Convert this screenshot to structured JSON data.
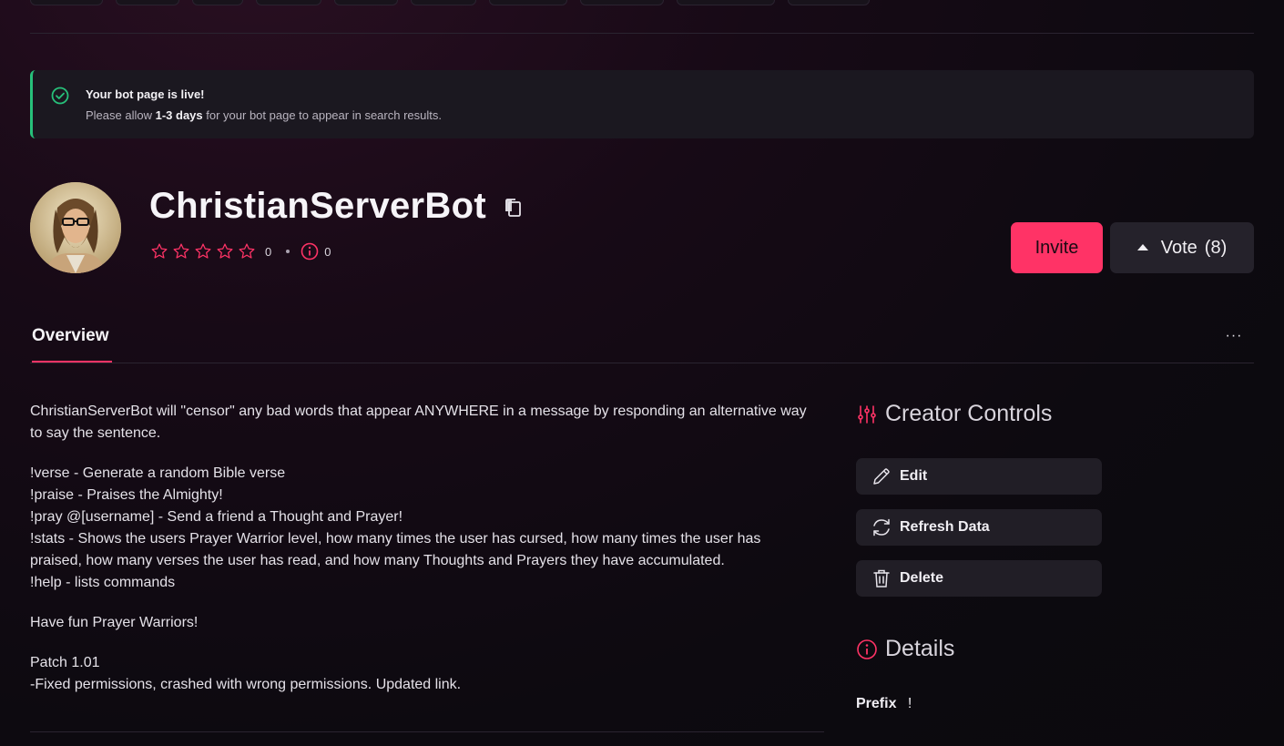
{
  "alert": {
    "title": "Your bot page is live!",
    "body_prefix": "Please allow ",
    "body_bold": "1-3 days",
    "body_suffix": " for your bot page to appear in search results.",
    "accent": "#27c07a"
  },
  "bot": {
    "name": "ChristianServerBot",
    "rating_count": "0",
    "reports_count": "0",
    "stars": 5
  },
  "actions": {
    "invite_label": "Invite",
    "vote_label": "Vote",
    "vote_count": "(8)",
    "accent": "#ff3366"
  },
  "tabs": [
    {
      "label": "Overview",
      "active": true
    }
  ],
  "more_label": "···",
  "description": {
    "intro": "ChristianServerBot will \"censor\" any bad words that appear ANYWHERE in a message by responding an alternative way to say the sentence.",
    "commands": [
      "!verse - Generate a random Bible verse",
      "!praise - Praises the Almighty!",
      "!pray @[username] - Send a friend a Thought and Prayer!",
      "!stats - Shows the users Prayer Warrior level, how many times the user has cursed, how many times the user has praised, how many verses the user has read, and how many Thoughts and Prayers they have accumulated.",
      "!help - lists commands"
    ],
    "outro": "Have fun Prayer Warriors!",
    "patch_title": "Patch 1.01",
    "patch_note": "-Fixed permissions, crashed with wrong permissions. Updated link."
  },
  "creator_controls": {
    "title": "Creator Controls",
    "buttons": {
      "edit": "Edit",
      "refresh": "Refresh Data",
      "delete": "Delete"
    }
  },
  "details": {
    "title": "Details",
    "prefix_label": "Prefix",
    "prefix_value": "!"
  },
  "icons": {
    "alert": "check-circle-icon",
    "copy": "copy-icon",
    "star": "star-outline-icon",
    "report": "info-circle-icon",
    "vote": "caret-up-icon",
    "controls": "sliders-icon",
    "edit": "pencil-icon",
    "refresh": "refresh-icon",
    "delete": "trash-icon",
    "details": "info-circle-icon"
  }
}
